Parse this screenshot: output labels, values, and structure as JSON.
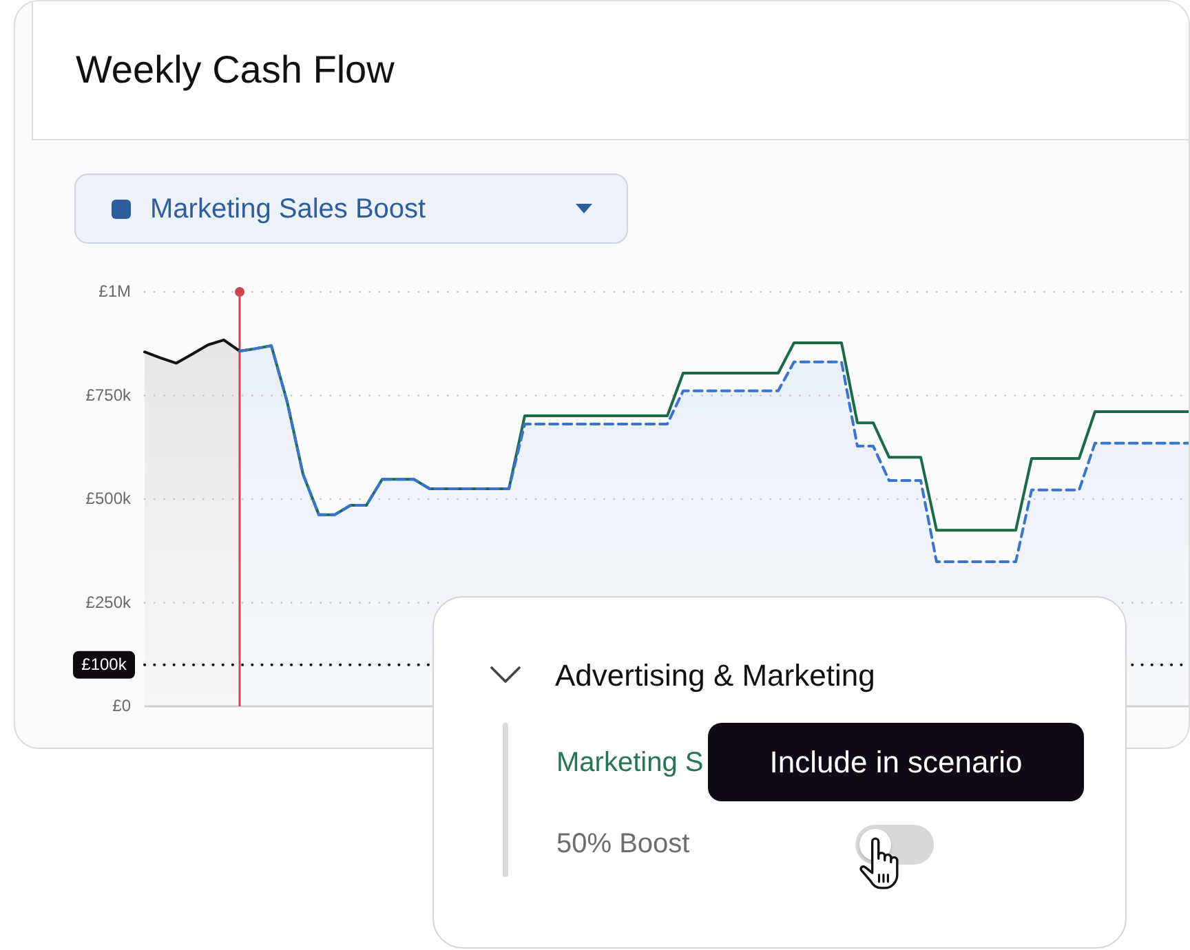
{
  "header": {
    "title": "Weekly Cash Flow"
  },
  "scenario_select": {
    "label": "Marketing Sales Boost"
  },
  "chart": {
    "chart_data": {
      "type": "line",
      "grid": true,
      "ylim": [
        0,
        1000000
      ],
      "yticks": [
        {
          "value": 0,
          "label": "£0"
        },
        {
          "value": 100000,
          "label": "£100k"
        },
        {
          "value": 250000,
          "label": "£250k"
        },
        {
          "value": 500000,
          "label": "£500k"
        },
        {
          "value": 750000,
          "label": "£750k"
        },
        {
          "value": 1000000,
          "label": "£1M"
        }
      ],
      "ref_lines": [
        {
          "axis": "y",
          "value": 100000
        }
      ],
      "categories": [
        null,
        null,
        null,
        null,
        null,
        null,
        null,
        null,
        null,
        null,
        null,
        null,
        null,
        null,
        null,
        null,
        null,
        null,
        null,
        null,
        null,
        null,
        null,
        null,
        null,
        null,
        null,
        null,
        null,
        null,
        null,
        null,
        null,
        null,
        null,
        null,
        null,
        null,
        null,
        null,
        null,
        null,
        null,
        null,
        null,
        null,
        null,
        null,
        null,
        null,
        null,
        null,
        null,
        null,
        null,
        null,
        null,
        null,
        null,
        null,
        null,
        null,
        null,
        null,
        null,
        null,
        null
      ],
      "series": [
        {
          "type": "area",
          "color": "#141414",
          "line_style": "solid",
          "values": [
            855000,
            841000,
            828000,
            850000,
            872000,
            884000,
            857000,
            null,
            null,
            null,
            null,
            null,
            null,
            null,
            null,
            null,
            null,
            null,
            null,
            null,
            null,
            null,
            null,
            null,
            null,
            null,
            null,
            null,
            null,
            null,
            null,
            null,
            null,
            null,
            null,
            null,
            null,
            null,
            null,
            null,
            null,
            null,
            null,
            null,
            null,
            null,
            null,
            null,
            null,
            null,
            null,
            null,
            null,
            null,
            null,
            null,
            null,
            null,
            null,
            null,
            null,
            null,
            null,
            null,
            null,
            null,
            null
          ]
        },
        {
          "type": "line",
          "color": "#1d6a48",
          "line_style": "solid",
          "values": [
            null,
            null,
            null,
            null,
            null,
            null,
            857000,
            863000,
            870000,
            735000,
            560000,
            462000,
            462000,
            485000,
            485000,
            548000,
            548000,
            548000,
            525000,
            525000,
            525000,
            525000,
            525000,
            525000,
            701000,
            701000,
            701000,
            701000,
            701000,
            701000,
            701000,
            701000,
            701000,
            701000,
            804000,
            804000,
            804000,
            804000,
            804000,
            804000,
            804000,
            877000,
            877000,
            877000,
            877000,
            684000,
            684000,
            601000,
            601000,
            601000,
            425000,
            425000,
            425000,
            425000,
            425000,
            425000,
            598000,
            598000,
            598000,
            598000,
            711000,
            711000,
            711000,
            711000,
            711000,
            711000,
            711000
          ]
        },
        {
          "type": "area",
          "color": "#3a74cc",
          "line_style": "dashed",
          "values": [
            null,
            null,
            null,
            null,
            null,
            null,
            857000,
            863000,
            870000,
            735000,
            560000,
            462000,
            462000,
            485000,
            485000,
            548000,
            548000,
            548000,
            525000,
            525000,
            525000,
            525000,
            525000,
            525000,
            681000,
            681000,
            681000,
            681000,
            681000,
            681000,
            681000,
            681000,
            681000,
            681000,
            761000,
            761000,
            761000,
            761000,
            761000,
            761000,
            761000,
            831000,
            831000,
            831000,
            831000,
            628000,
            628000,
            545000,
            545000,
            545000,
            349000,
            349000,
            349000,
            349000,
            349000,
            349000,
            522000,
            522000,
            522000,
            522000,
            635000,
            635000,
            635000,
            635000,
            635000,
            635000,
            635000
          ]
        }
      ]
    }
  },
  "category_panel": {
    "title": "Advertising & Marketing",
    "expanded": true,
    "items": [
      {
        "kind": "scenario",
        "label": "Marketing S"
      },
      {
        "kind": "toggle",
        "label": "50% Boost",
        "on": false
      }
    ]
  },
  "tooltip": {
    "text": "Include in scenario"
  }
}
